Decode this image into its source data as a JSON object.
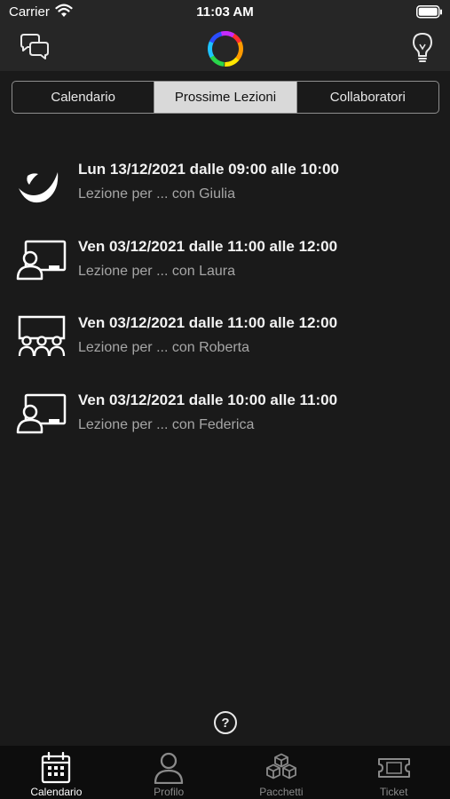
{
  "status_bar": {
    "carrier": "Carrier",
    "time": "11:03 AM"
  },
  "nav": {
    "left_icon": "chat-bubbles-icon",
    "center_icon": "color-ring-logo",
    "right_icon": "lightbulb-icon"
  },
  "segments": [
    {
      "label": "Calendario",
      "active": false
    },
    {
      "label": "Prossime Lezioni",
      "active": true
    },
    {
      "label": "Collaboratori",
      "active": false
    }
  ],
  "lessons": [
    {
      "title": "Lun 13/12/2021 dalle 09:00 alle 10:00",
      "subtitle": "Lezione per ... con Giulia",
      "icon": "wave-logo-icon"
    },
    {
      "title": "Ven 03/12/2021 dalle 11:00 alle 12:00",
      "subtitle": "Lezione per ... con Laura",
      "icon": "teacher-board-icon"
    },
    {
      "title": "Ven 03/12/2021 dalle 11:00 alle 12:00",
      "subtitle": "Lezione per ... con Roberta",
      "icon": "classroom-group-icon"
    },
    {
      "title": "Ven 03/12/2021 dalle 10:00 alle 11:00",
      "subtitle": "Lezione per ... con Federica",
      "icon": "teacher-board-icon"
    }
  ],
  "help": {
    "label": "?"
  },
  "tabs": [
    {
      "label": "Calendario",
      "icon": "calendar-icon",
      "active": true
    },
    {
      "label": "Profilo",
      "icon": "person-icon",
      "active": false
    },
    {
      "label": "Pacchetti",
      "icon": "boxes-icon",
      "active": false
    },
    {
      "label": "Ticket",
      "icon": "ticket-icon",
      "active": false
    }
  ],
  "colors": {
    "background": "#1a1a1a",
    "bar": "#262626",
    "tab_bar": "#0d0d0d",
    "segment_active": "#d9d9d9",
    "subtitle": "#a6a6a6"
  }
}
